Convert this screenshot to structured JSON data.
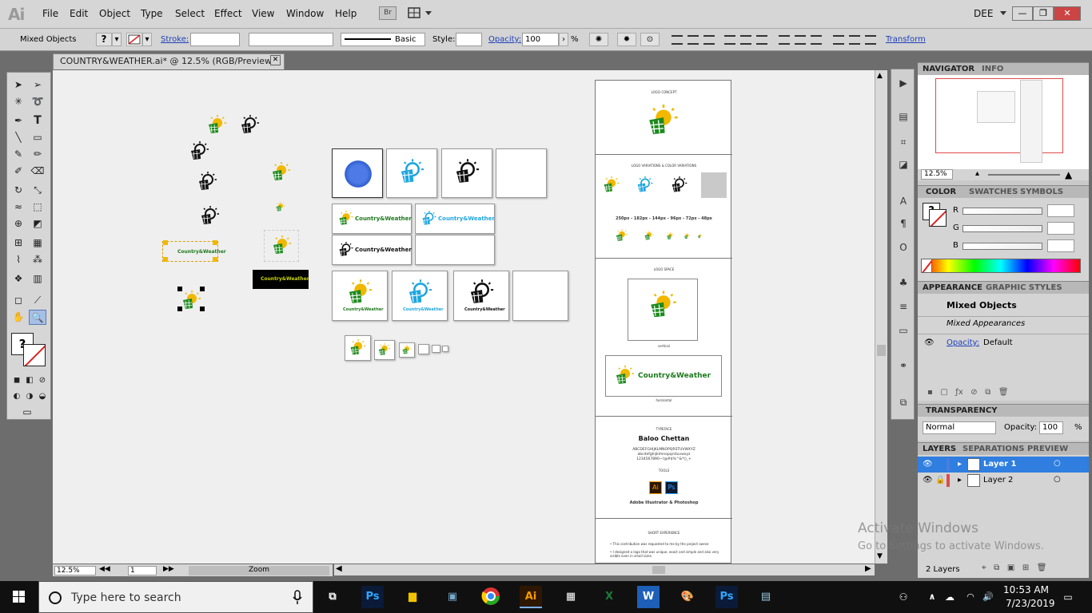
{
  "app": {
    "logo": "Ai",
    "menu": [
      "File",
      "Edit",
      "Object",
      "Type",
      "Select",
      "Effect",
      "View",
      "Window",
      "Help"
    ],
    "bridge_label": "Br",
    "workspace": "DEE",
    "window_buttons": {
      "minimize": "—",
      "restore": "❐",
      "close": "✕"
    }
  },
  "control_bar": {
    "selection": "Mixed Objects",
    "fill_swatch": "?",
    "stroke_label": "Stroke:",
    "stroke_profile": "Basic",
    "style_label": "Style:",
    "opacity_label": "Opacity:",
    "opacity_value": "100",
    "opacity_unit": "%",
    "transform_label": "Transform"
  },
  "document": {
    "tab_title": "COUNTRY&WEATHER.ai* @ 12.5% (RGB/Preview)",
    "zoom": "12.5%",
    "artboard_number": "1",
    "status_label": "Zoom",
    "brand_name": "Country&Weather",
    "sheet": {
      "logo_concept": "LOGO CONCEPT",
      "color_variations": "LOGO VARIATIONS & COLOR VARIATIONS",
      "sizes": "250px - 182px - 144px - 96px - 72px - 48px",
      "logo_space": "LOGO SPACE",
      "vertical": "vertical",
      "horizontal": "horizontal",
      "typeface_heading": "TYPEFACE",
      "typeface": "Baloo Chettan",
      "alphabet_upper": "ABCDEFGHIJKLMNOPQRSTUVWXYZ",
      "alphabet_lower": "abcdefghijklmnopqrstuvwxyz",
      "digits": "1234567890~!@#$%^&*()_+",
      "tools_heading": "TOOLS",
      "tool_ai": "Ai",
      "tool_ps": "Ps",
      "tools_text": "Adobe Illustrator & Photoshop",
      "brief_heading": "SHORT EXPERIENCE",
      "brief_1": "• This contribution was requested to me by the project owner.",
      "brief_2": "• I designed a logo that was unique, exact and simple and also very visible even in small sizes."
    }
  },
  "navigator": {
    "tab1": "NAVIGATOR",
    "tab2": "INFO",
    "zoom": "12.5%"
  },
  "color_panel": {
    "tabs": [
      "COLOR",
      "SWATCHES",
      "SYMBOLS"
    ],
    "channels": [
      "R",
      "G",
      "B"
    ],
    "swatch": "?"
  },
  "appearance": {
    "tabs": [
      "APPEARANCE",
      "GRAPHIC STYLES"
    ],
    "title": "Mixed Objects",
    "subtitle": "Mixed Appearances",
    "opacity_label": "Opacity:",
    "opacity_value": "Default"
  },
  "transparency": {
    "tab": "TRANSPARENCY",
    "blend_mode": "Normal",
    "opacity_label": "Opacity:",
    "opacity_value": "100",
    "unit": "%"
  },
  "layers": {
    "tabs": [
      "LAYERS",
      "SEPARATIONS PREVIEW"
    ],
    "items": [
      {
        "name": "Layer 1",
        "color": "#4a7de0"
      },
      {
        "name": "Layer 2",
        "color": "#e04a4a"
      }
    ],
    "count": "2 Layers"
  },
  "taskbar": {
    "search_placeholder": "Type here to search",
    "time": "10:53 AM",
    "date": "7/23/2019",
    "apps": [
      "Ps",
      "Ai",
      "W",
      "Ps"
    ]
  },
  "watermark": {
    "line1": "Activate Windows",
    "line2": "Go to Settings to activate Windows."
  },
  "colors": {
    "accent_yellow": "#f2b800",
    "logo_green": "#1d8a1d",
    "logo_blue": "#1ea6e0",
    "selection_blue": "#2f7ee0"
  }
}
